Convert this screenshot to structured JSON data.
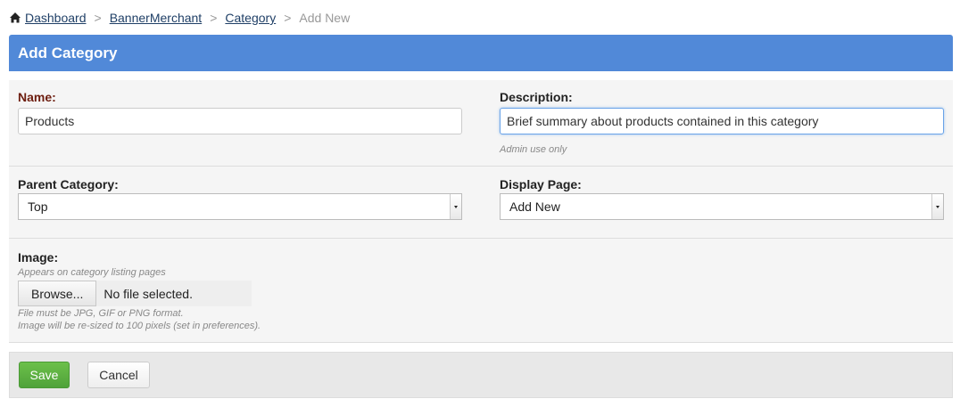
{
  "breadcrumb": {
    "icon": "home-icon",
    "items": [
      {
        "label": "Dashboard"
      },
      {
        "label": "BannerMerchant"
      },
      {
        "label": "Category"
      }
    ],
    "current": "Add New",
    "separator": ">"
  },
  "header": {
    "title": "Add Category"
  },
  "form": {
    "name": {
      "label": "Name:",
      "value": "Products"
    },
    "description": {
      "label": "Description:",
      "value": "Brief summary about products contained in this category",
      "help": "Admin use only"
    },
    "parent_category": {
      "label": "Parent Category:",
      "selected": "Top"
    },
    "display_page": {
      "label": "Display Page:",
      "selected": "Add New"
    },
    "image": {
      "label": "Image:",
      "help_top": "Appears on category listing pages",
      "browse_label": "Browse...",
      "status": "No file selected.",
      "help_format": "File must be JPG, GIF or PNG format.",
      "help_resize": "Image will be re-sized to 100 pixels (set in preferences)."
    }
  },
  "footer": {
    "save_label": "Save",
    "cancel_label": "Cancel"
  },
  "colors": {
    "header_bg": "#5189d8",
    "save_bg": "#5cb145",
    "link": "#1f3f66"
  }
}
